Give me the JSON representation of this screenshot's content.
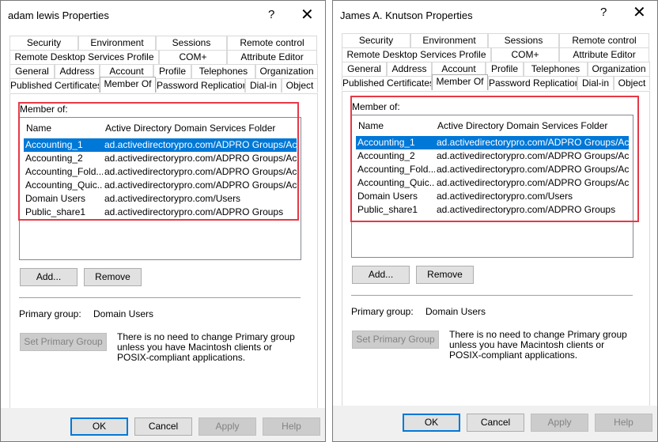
{
  "tabs_row1": [
    "Security",
    "Environment",
    "Sessions",
    "Remote control"
  ],
  "tabs_row2": [
    "Remote Desktop Services Profile",
    "COM+",
    "Attribute Editor"
  ],
  "tabs_row3": [
    "General",
    "Address",
    "Account",
    "Profile",
    "Telephones",
    "Organization"
  ],
  "tabs_row4": [
    "Published Certificates",
    "Member Of",
    "Password Replication",
    "Dial-in",
    "Object"
  ],
  "member_of_label": "Member of:",
  "col_name": "Name",
  "col_folder": "Active Directory Domain Services Folder",
  "members": [
    {
      "name": "Accounting_1",
      "folder": "ad.activedirectorypro.com/ADPRO Groups/Acco..."
    },
    {
      "name": "Accounting_2",
      "folder": "ad.activedirectorypro.com/ADPRO Groups/Acco..."
    },
    {
      "name": "Accounting_Fold...",
      "folder": "ad.activedirectorypro.com/ADPRO Groups/Acco..."
    },
    {
      "name": "Accounting_Quic...",
      "folder": "ad.activedirectorypro.com/ADPRO Groups/Acco..."
    },
    {
      "name": "Domain Users",
      "folder": "ad.activedirectorypro.com/Users"
    },
    {
      "name": "Public_share1",
      "folder": "ad.activedirectorypro.com/ADPRO Groups"
    }
  ],
  "add_label": "Add...",
  "remove_label": "Remove",
  "primary_group_label": "Primary group:",
  "primary_group_value": "Domain Users",
  "set_primary_label": "Set Primary Group",
  "note": "There is no need to change Primary group unless you have Macintosh clients or POSIX-compliant applications.",
  "ok_label": "OK",
  "cancel_label": "Cancel",
  "apply_label": "Apply",
  "help_label": "Help",
  "help_glyph": "?",
  "close_glyph": "✕",
  "left": {
    "title": "adam lewis Properties"
  },
  "right": {
    "title": "James A. Knutson Properties"
  },
  "colors": {
    "selection": "#0078d7",
    "highlight_box": "#e63946"
  }
}
